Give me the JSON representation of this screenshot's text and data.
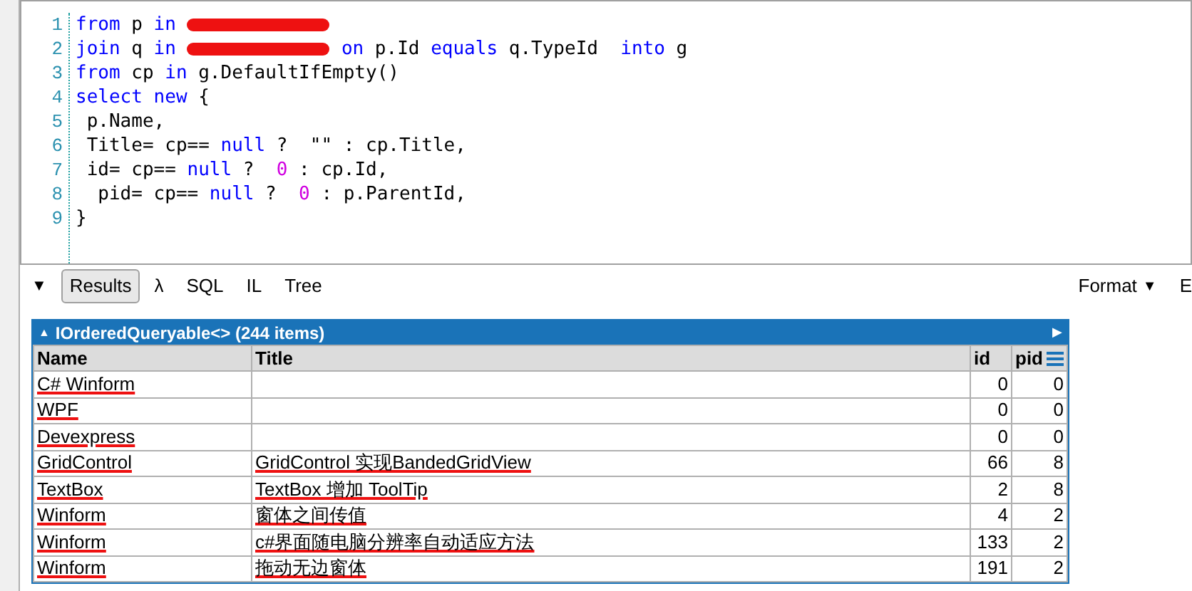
{
  "editor": {
    "lines": [
      {
        "number": "1",
        "segments": [
          {
            "kind": "keyword",
            "text": "from"
          },
          {
            "kind": "plain",
            "text": " p "
          },
          {
            "kind": "keyword",
            "text": "in"
          },
          {
            "kind": "redacted"
          }
        ]
      },
      {
        "number": "2",
        "segments": [
          {
            "kind": "keyword",
            "text": "join"
          },
          {
            "kind": "plain",
            "text": " q "
          },
          {
            "kind": "keyword",
            "text": "in"
          },
          {
            "kind": "redacted"
          },
          {
            "kind": "keyword",
            "text": "on"
          },
          {
            "kind": "plain",
            "text": " p.Id "
          },
          {
            "kind": "keyword",
            "text": "equals"
          },
          {
            "kind": "plain",
            "text": " q.TypeId  "
          },
          {
            "kind": "keyword",
            "text": "into"
          },
          {
            "kind": "plain",
            "text": " g"
          }
        ]
      },
      {
        "number": "3",
        "segments": [
          {
            "kind": "keyword",
            "text": "from"
          },
          {
            "kind": "plain",
            "text": " cp "
          },
          {
            "kind": "keyword",
            "text": "in"
          },
          {
            "kind": "plain",
            "text": " g.DefaultIfEmpty()"
          }
        ]
      },
      {
        "number": "4",
        "segments": [
          {
            "kind": "keyword",
            "text": "select"
          },
          {
            "kind": "keyword",
            "text": " new"
          },
          {
            "kind": "plain",
            "text": " {"
          }
        ]
      },
      {
        "number": "5",
        "segments": [
          {
            "kind": "plain",
            "text": " p.Name,"
          }
        ]
      },
      {
        "number": "6",
        "segments": [
          {
            "kind": "plain",
            "text": " Title= cp== "
          },
          {
            "kind": "keyword",
            "text": "null"
          },
          {
            "kind": "plain",
            "text": " ?  \"\" : cp.Title,"
          }
        ]
      },
      {
        "number": "7",
        "segments": [
          {
            "kind": "plain",
            "text": " id= cp== "
          },
          {
            "kind": "keyword",
            "text": "null"
          },
          {
            "kind": "plain",
            "text": " ?  "
          },
          {
            "kind": "number",
            "text": "0"
          },
          {
            "kind": "plain",
            "text": " : cp.Id,"
          }
        ]
      },
      {
        "number": "8",
        "segments": [
          {
            "kind": "plain",
            "text": "  pid= cp== "
          },
          {
            "kind": "keyword",
            "text": "null"
          },
          {
            "kind": "plain",
            "text": " ?  "
          },
          {
            "kind": "number",
            "text": "0"
          },
          {
            "kind": "plain",
            "text": " : p.ParentId,"
          }
        ]
      },
      {
        "number": "9",
        "segments": [
          {
            "kind": "plain",
            "text": "}"
          }
        ]
      }
    ]
  },
  "toolbar": {
    "collapse": "▼",
    "tabs": [
      {
        "label": "Results",
        "selected": true
      },
      {
        "label": "λ",
        "selected": false
      },
      {
        "label": "SQL",
        "selected": false
      },
      {
        "label": "IL",
        "selected": false
      },
      {
        "label": "Tree",
        "selected": false
      }
    ],
    "format": "Format",
    "format_caret": "▼",
    "cut_item": "E"
  },
  "results": {
    "title": "IOrderedQueryable<> (244 items)",
    "collapse": "▲",
    "expand": "▶",
    "columns": [
      "Name",
      "Title",
      "id",
      "pid"
    ],
    "rows": [
      {
        "name": "C# Winform",
        "title": "",
        "id": "0",
        "pid": "0",
        "redacted": true
      },
      {
        "name": "WPF",
        "title": "",
        "id": "0",
        "pid": "0",
        "redacted": true
      },
      {
        "name": "Devexpress",
        "title": "",
        "id": "0",
        "pid": "0",
        "redacted": true
      },
      {
        "name": "GridControl",
        "title": "GridControl 实现BandedGridView",
        "id": "66",
        "pid": "8",
        "redacted": true
      },
      {
        "name": "TextBox",
        "title": "TextBox 增加 ToolTip",
        "id": "2",
        "pid": "8",
        "redacted": true
      },
      {
        "name": "Winform",
        "title": "窗体之间传值",
        "id": "4",
        "pid": "2",
        "redacted": true
      },
      {
        "name": "Winform",
        "title": "c#界面随电脑分辨率自动适应方法",
        "id": "133",
        "pid": "2",
        "redacted": true
      },
      {
        "name": "Winform",
        "title": "拖动无边窗体",
        "id": "191",
        "pid": "2",
        "redacted": true
      }
    ]
  }
}
